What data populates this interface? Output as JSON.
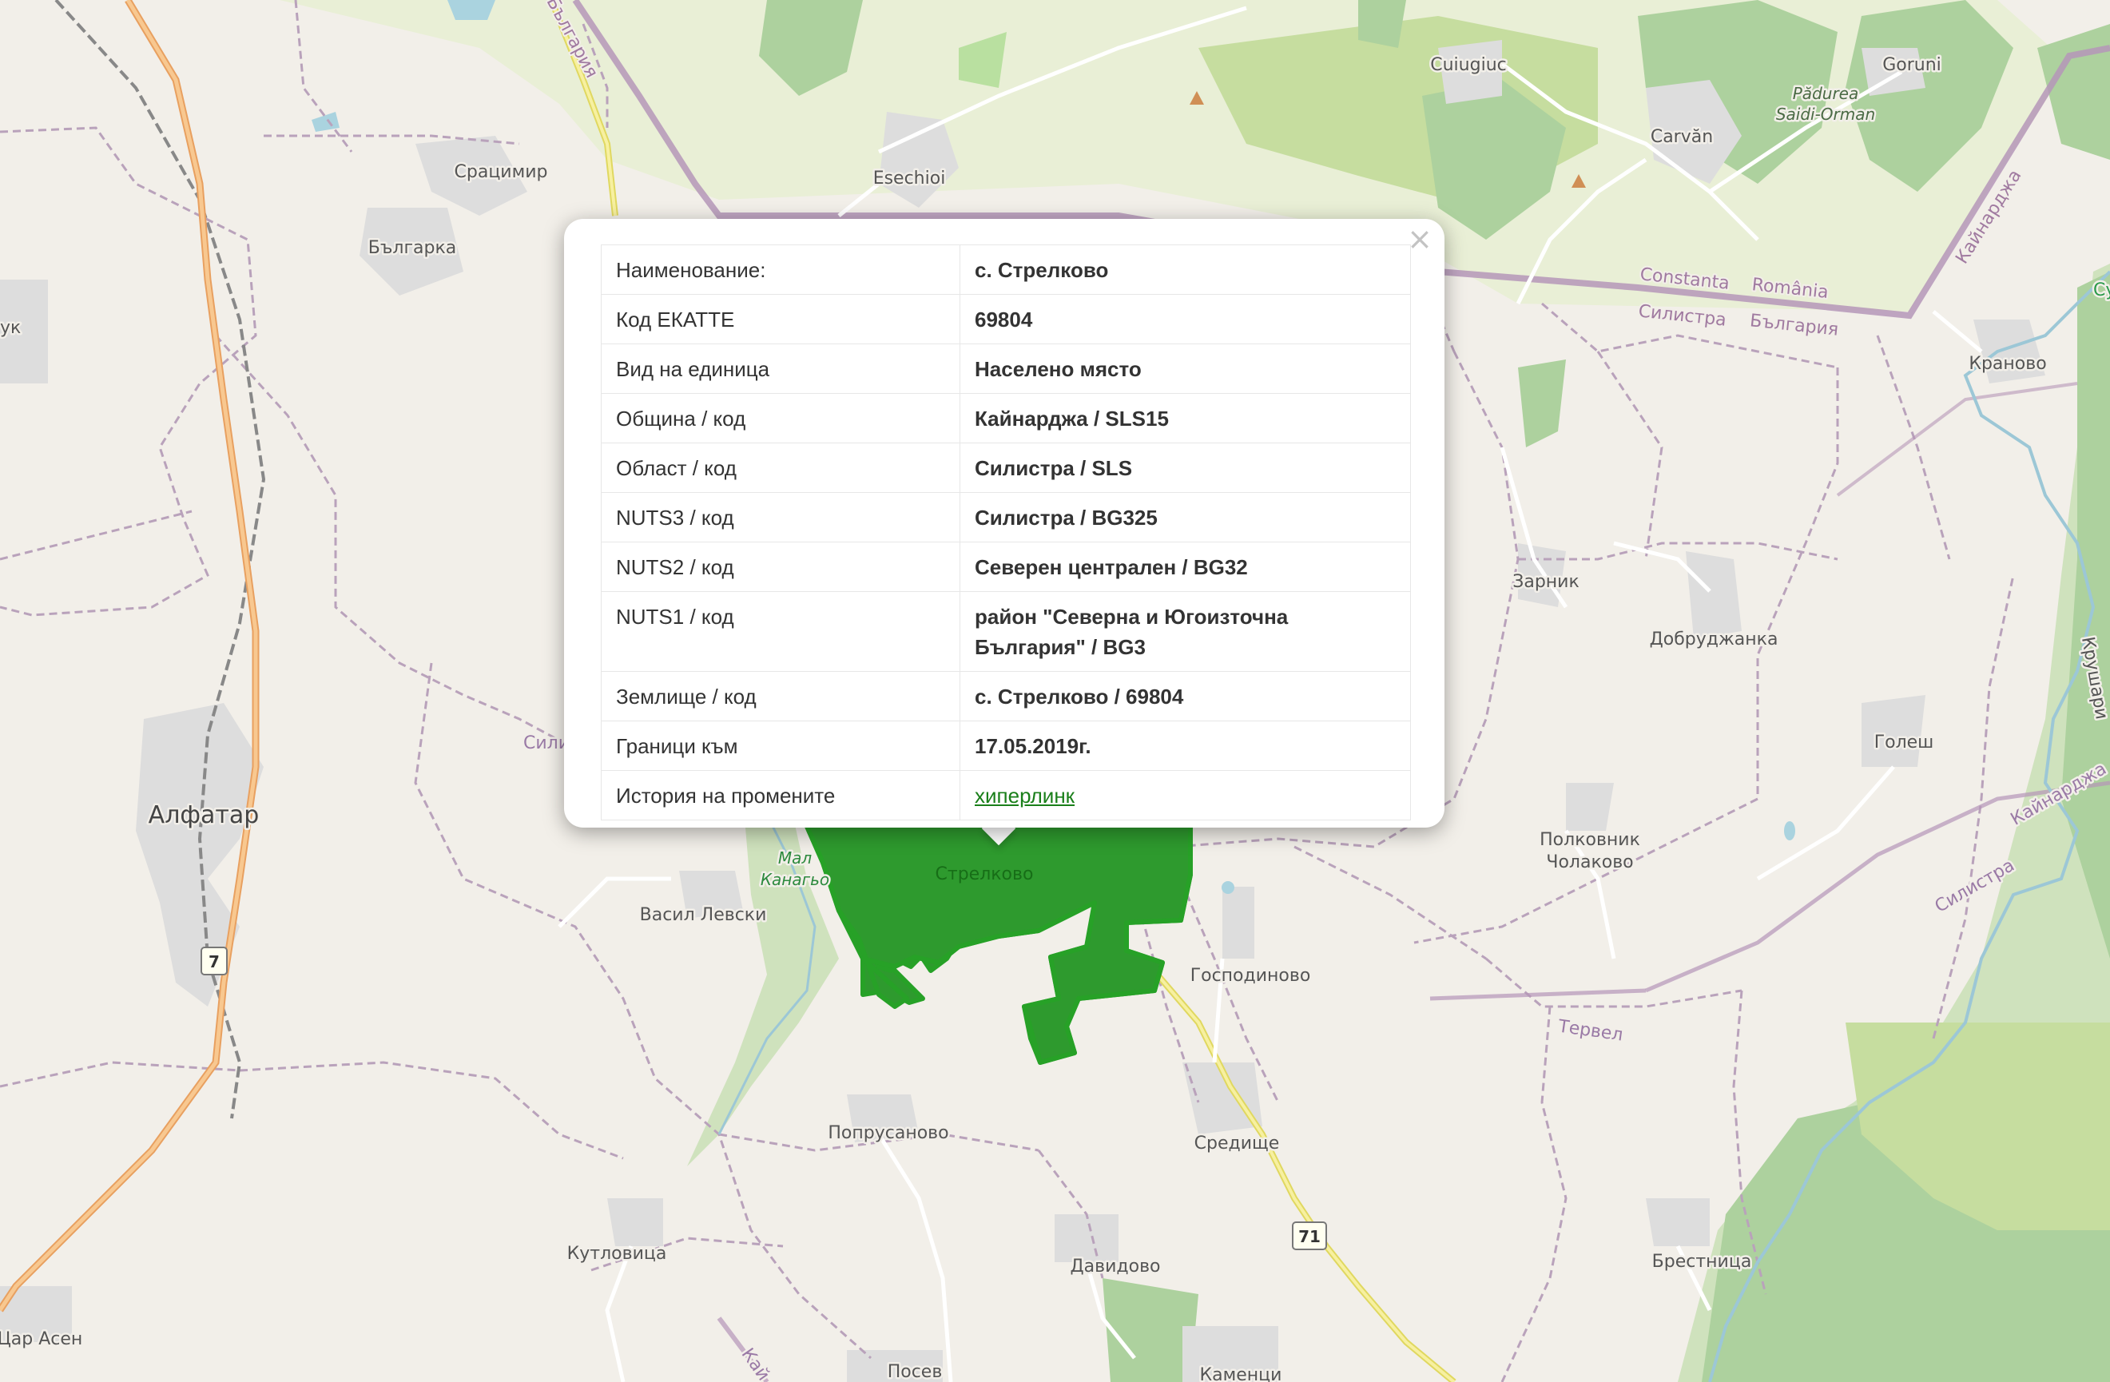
{
  "map": {
    "labels": {
      "alfatar": "Алфатар",
      "sratsimir": "Срацимир",
      "bulgarka": "Българка",
      "esechioi": "Esechioi",
      "cuiugiuc": "Cuiugiuc",
      "goruni": "Goruni",
      "carvan": "Carvăn",
      "padurea": "Pădurea Saidi-Orman",
      "padurea_1": "Pădurea",
      "padurea_2": "Saidi-Orman",
      "constanta": "Constanta",
      "romania": "România",
      "silistra_b": "Силистра",
      "bulgaria_b": "България",
      "bulgaria_top": "България",
      "kaynardzha_edge": "Кайнарджа",
      "sukh": "Сух",
      "kranovo": "Краново",
      "zarnik": "Зарник",
      "dobrudzhanka": "Добруджанка",
      "krushari": "Крушари",
      "golesh": "Голеш",
      "polkovnik_1": "Полковник",
      "polkovnik_2": "Чолаково",
      "kaynardzha_r": "Кайнарджа",
      "silistra_r": "Силистра",
      "tervel": "Тервел",
      "vasil_levski": "Васил Левски",
      "strelkovo": "Стрелково",
      "gospodinovo": "Господиново",
      "popprusanovo": "Попрусаново",
      "sredishte": "Средище",
      "kutlovitsa": "Кутловица",
      "davidovo": "Давидово",
      "brestnitsa": "Брестница",
      "tsar_asen": "Цар Асен",
      "posev": "Посев",
      "kamentsi": "Каменци",
      "malak_1": "Мал",
      "malak_2": "Канагьо",
      "sili_left": "Сили",
      "uk_left": "ук",
      "kay_bottom": "Кай",
      "road7": "7",
      "road71": "71"
    }
  },
  "popup": {
    "close_glyph": "×",
    "rows": [
      {
        "key": "Наименование:",
        "value": "с. Стрелково"
      },
      {
        "key": "Код ЕКАТТЕ",
        "value": "69804"
      },
      {
        "key": "Вид на единица",
        "value": "Населено място"
      },
      {
        "key": "Община / код",
        "value": "Кайнарджа / SLS15"
      },
      {
        "key": "Област / код",
        "value": "Силистра / SLS"
      },
      {
        "key": "NUTS3 / код",
        "value": "Силистра / BG325"
      },
      {
        "key": "NUTS2 / код",
        "value": "Северен централен / BG32"
      },
      {
        "key": "NUTS1 / код",
        "value_line1": "район \"Северна и Югоизточна",
        "value_line2": "България\" / BG3"
      },
      {
        "key": "Землище / код",
        "value": "с. Стрелково / 69804"
      },
      {
        "key": "Граници към",
        "value": "17.05.2019г."
      },
      {
        "key": "История на промените",
        "link": "хиперлинк"
      }
    ]
  },
  "colors": {
    "background": "#f2efe9",
    "forest": "#add19e",
    "polygon_fill": "#2e9a2e",
    "polygon_stroke": "#27a127",
    "link": "#1a7f1a",
    "border_line": "#b596b8",
    "motorway": "#f4b16f"
  }
}
